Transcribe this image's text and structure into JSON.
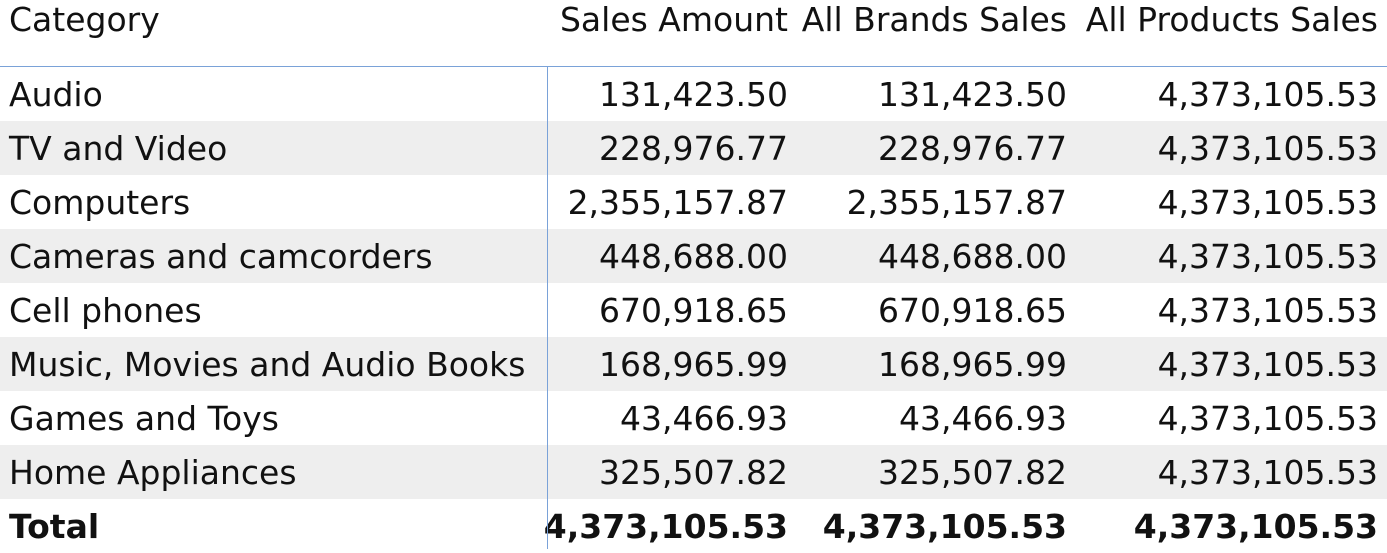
{
  "columns": [
    "Category",
    "Sales Amount",
    "All Brands Sales",
    "All Products Sales"
  ],
  "rows": [
    {
      "category": "Audio",
      "sales_amount": "131,423.50",
      "all_brands_sales": "131,423.50",
      "all_products_sales": "4,373,105.53"
    },
    {
      "category": "TV and Video",
      "sales_amount": "228,976.77",
      "all_brands_sales": "228,976.77",
      "all_products_sales": "4,373,105.53"
    },
    {
      "category": "Computers",
      "sales_amount": "2,355,157.87",
      "all_brands_sales": "2,355,157.87",
      "all_products_sales": "4,373,105.53"
    },
    {
      "category": "Cameras and camcorders",
      "sales_amount": "448,688.00",
      "all_brands_sales": "448,688.00",
      "all_products_sales": "4,373,105.53"
    },
    {
      "category": "Cell phones",
      "sales_amount": "670,918.65",
      "all_brands_sales": "670,918.65",
      "all_products_sales": "4,373,105.53"
    },
    {
      "category": "Music, Movies and Audio Books",
      "sales_amount": "168,965.99",
      "all_brands_sales": "168,965.99",
      "all_products_sales": "4,373,105.53"
    },
    {
      "category": "Games and Toys",
      "sales_amount": "43,466.93",
      "all_brands_sales": "43,466.93",
      "all_products_sales": "4,373,105.53"
    },
    {
      "category": "Home Appliances",
      "sales_amount": "325,507.82",
      "all_brands_sales": "325,507.82",
      "all_products_sales": "4,373,105.53"
    }
  ],
  "total": {
    "label": "Total",
    "sales_amount": "4,373,105.53",
    "all_brands_sales": "4,373,105.53",
    "all_products_sales": "4,373,105.53"
  },
  "colors": {
    "grid_line": "#7aa2d8",
    "row_shade": "#eeeeee",
    "text": "#111111"
  }
}
